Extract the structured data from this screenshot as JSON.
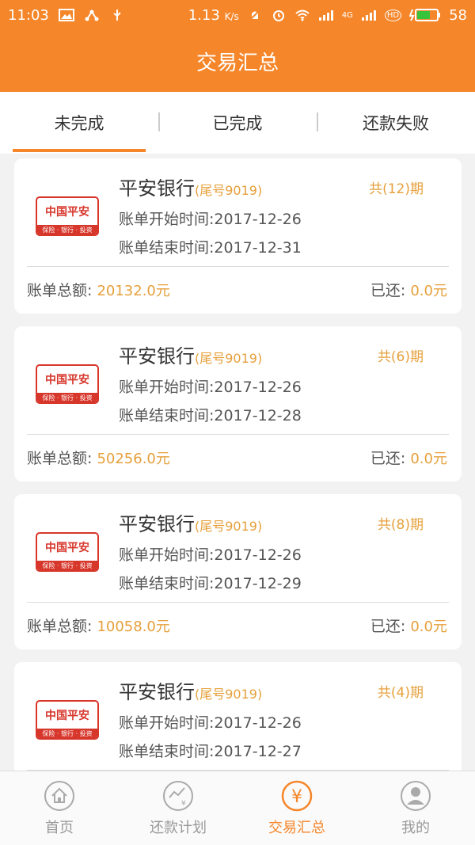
{
  "status_bar": {
    "time": "11:03",
    "speed": "1.13",
    "speed_unit": "K/s",
    "network_badge": "4G",
    "hd_badge": "HD",
    "battery": "58",
    "icons": [
      "image-icon",
      "usb-icon",
      "mute-icon",
      "alarm-icon",
      "wifi-icon",
      "signal-icon",
      "battery-icon"
    ]
  },
  "header": {
    "title": "交易汇总"
  },
  "tabs": [
    {
      "label": "未完成",
      "active": true
    },
    {
      "label": "已完成",
      "active": false
    },
    {
      "label": "还款失败",
      "active": false
    }
  ],
  "logo": {
    "name": "中国平安",
    "tagline": "保险 · 银行 · 投资"
  },
  "labels": {
    "start": "账单开始时间:",
    "end": "账单结束时间:",
    "total": "账单总额:",
    "paid": "已还:"
  },
  "bills": [
    {
      "bank": "平安银行",
      "tail": "(尾号9019)",
      "periods": "共(12)期",
      "start": "2017-12-26",
      "end": "2017-12-31",
      "total": "20132.0元",
      "paid": "0.0元"
    },
    {
      "bank": "平安银行",
      "tail": "(尾号9019)",
      "periods": "共(6)期",
      "start": "2017-12-26",
      "end": "2017-12-28",
      "total": "50256.0元",
      "paid": "0.0元"
    },
    {
      "bank": "平安银行",
      "tail": "(尾号9019)",
      "periods": "共(8)期",
      "start": "2017-12-26",
      "end": "2017-12-29",
      "total": "10058.0元",
      "paid": "0.0元"
    },
    {
      "bank": "平安银行",
      "tail": "(尾号9019)",
      "periods": "共(4)期",
      "start": "2017-12-26",
      "end": "2017-12-27",
      "total": "",
      "paid": ""
    }
  ],
  "bottom_nav": [
    {
      "label": "首页",
      "icon": "home-icon",
      "active": false
    },
    {
      "label": "还款计划",
      "icon": "repayment-plan-icon",
      "active": false
    },
    {
      "label": "交易汇总",
      "icon": "yuan-icon",
      "active": true
    },
    {
      "label": "我的",
      "icon": "user-icon",
      "active": false
    }
  ],
  "colors": {
    "accent": "#f5862a",
    "amount": "#e6a03c",
    "logo_red": "#d7362b"
  }
}
